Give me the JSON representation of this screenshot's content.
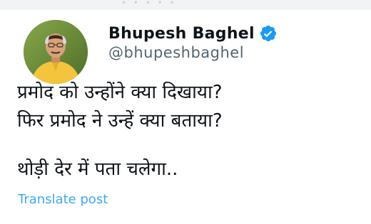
{
  "author": {
    "display_name": "Bhupesh Baghel",
    "handle": "@bhupeshbaghel",
    "verified": true,
    "avatar_icon": "profile-photo",
    "verified_icon": "verified-badge-icon",
    "verified_color": "#1d9bf0"
  },
  "post": {
    "lines": [
      "प्रमोद को उन्होंने क्या दिखाया?",
      "फिर प्रमोद ने उन्हें क्या बताया?",
      "थोड़ी देर में पता चलेगा.."
    ]
  },
  "actions": {
    "translate_label": "Translate post",
    "link_color": "#1d9bf0"
  }
}
